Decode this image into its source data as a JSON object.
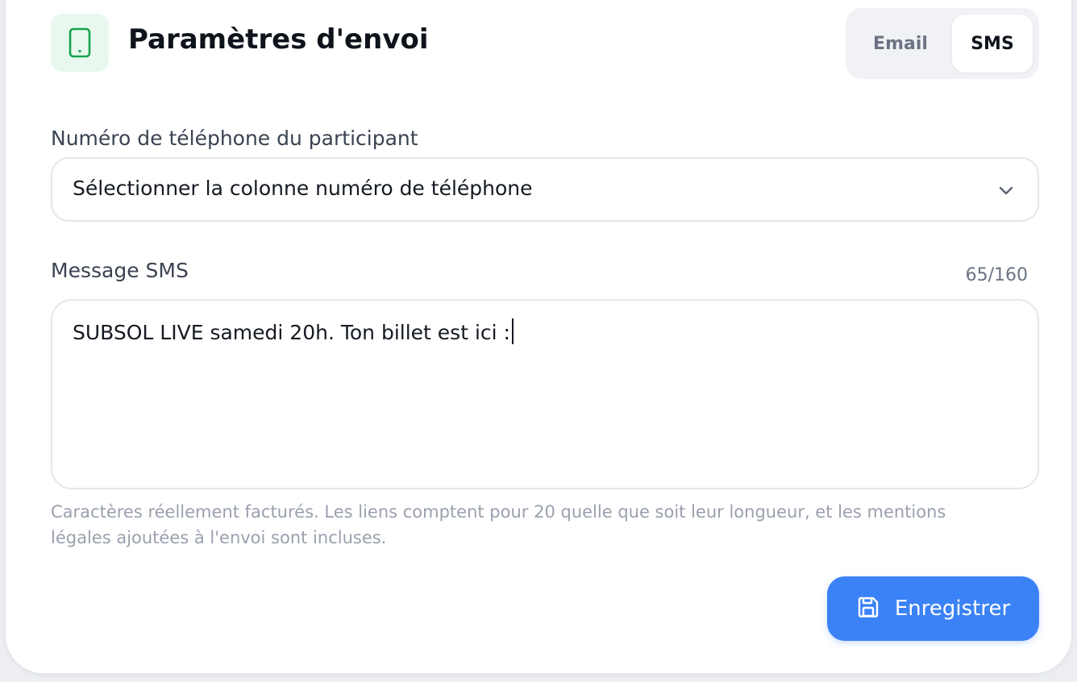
{
  "header": {
    "title": "Paramètres d'envoi",
    "icon": "smartphone-icon",
    "icon_color": "#16a34a"
  },
  "channel_toggle": {
    "options": [
      "Email",
      "SMS"
    ],
    "selected": "SMS"
  },
  "phone_field": {
    "label": "Numéro de téléphone du participant",
    "selected_value": "Sélectionner la colonne numéro de téléphone",
    "icon": "chevron-down-icon"
  },
  "message_field": {
    "label": "Message SMS",
    "counter": "65/160",
    "value": "SUBSOL LIVE samedi 20h. Ton billet est ici :",
    "hint": "Caractères réellement facturés. Les liens comptent pour 20 quelle que soit leur longueur, et les mentions légales ajoutées à l'envoi sont incluses."
  },
  "save_button": {
    "label": "Enregistrer",
    "icon": "save-icon",
    "color": "#3b82f6"
  }
}
